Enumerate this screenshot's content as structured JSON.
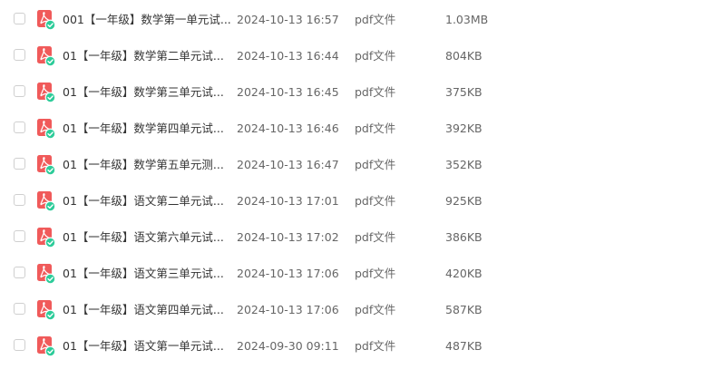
{
  "icons": {
    "file_icon": "pdf-file-icon",
    "status_icon": "synced-check-icon",
    "pdf_color": "#f05a5a",
    "check_color": "#2ecc9a"
  },
  "files": [
    {
      "name": "001【一年级】数学第一单元试...",
      "date": "2024-10-13 16:57",
      "type": "pdf文件",
      "size": "1.03MB"
    },
    {
      "name": "01【一年级】数学第二单元试...",
      "date": "2024-10-13 16:44",
      "type": "pdf文件",
      "size": "804KB"
    },
    {
      "name": "01【一年级】数学第三单元试...",
      "date": "2024-10-13 16:45",
      "type": "pdf文件",
      "size": "375KB"
    },
    {
      "name": "01【一年级】数学第四单元试...",
      "date": "2024-10-13 16:46",
      "type": "pdf文件",
      "size": "392KB"
    },
    {
      "name": "01【一年级】数学第五单元测...",
      "date": "2024-10-13 16:47",
      "type": "pdf文件",
      "size": "352KB"
    },
    {
      "name": "01【一年级】语文第二单元试...",
      "date": "2024-10-13 17:01",
      "type": "pdf文件",
      "size": "925KB"
    },
    {
      "name": "01【一年级】语文第六单元试...",
      "date": "2024-10-13 17:02",
      "type": "pdf文件",
      "size": "386KB"
    },
    {
      "name": "01【一年级】语文第三单元试...",
      "date": "2024-10-13 17:06",
      "type": "pdf文件",
      "size": "420KB"
    },
    {
      "name": "01【一年级】语文第四单元试...",
      "date": "2024-10-13 17:06",
      "type": "pdf文件",
      "size": "587KB"
    },
    {
      "name": "01【一年级】语文第一单元试...",
      "date": "2024-09-30 09:11",
      "type": "pdf文件",
      "size": "487KB"
    }
  ]
}
